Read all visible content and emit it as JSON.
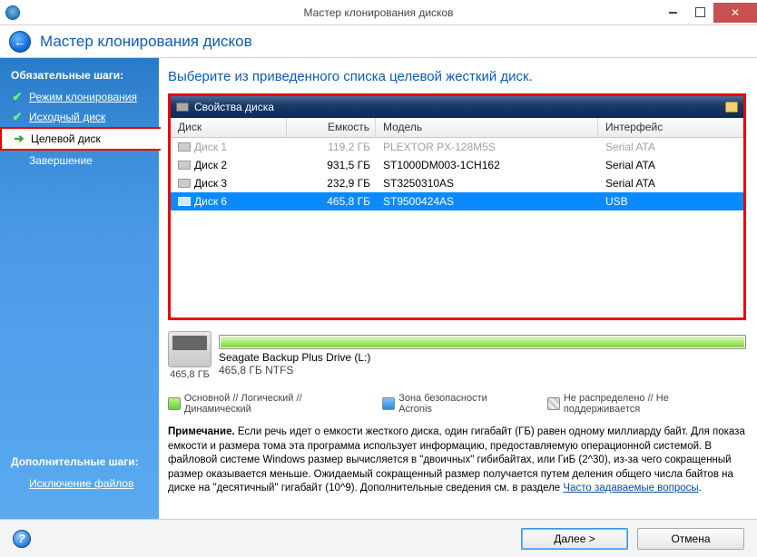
{
  "window": {
    "title": "Мастер клонирования дисков"
  },
  "header": {
    "title": "Мастер клонирования дисков"
  },
  "sidebar": {
    "required_label": "Обязательные шаги:",
    "additional_label": "Дополнительные шаги:",
    "items": [
      {
        "label": "Режим клонирования",
        "done": true
      },
      {
        "label": "Исходный диск",
        "done": true
      },
      {
        "label": "Целевой диск",
        "active": true
      },
      {
        "label": "Завершение"
      }
    ],
    "additional_items": [
      {
        "label": "Исключение файлов"
      }
    ]
  },
  "main": {
    "heading": "Выберите из приведенного списка целевой жесткий диск.",
    "panel_title": "Свойства диска",
    "columns": {
      "disk": "Диск",
      "capacity": "Емкость",
      "model": "Модель",
      "interface": "Интерфейс"
    },
    "rows": [
      {
        "disk": "Диск 1",
        "capacity": "119,2 ГБ",
        "model": "PLEXTOR PX-128M5S",
        "iface": "Serial ATA",
        "state": "disabled"
      },
      {
        "disk": "Диск 2",
        "capacity": "931,5 ГБ",
        "model": "ST1000DM003-1CH162",
        "iface": "Serial ATA",
        "state": "normal"
      },
      {
        "disk": "Диск 3",
        "capacity": "232,9 ГБ",
        "model": "ST3250310AS",
        "iface": "Serial ATA",
        "state": "normal"
      },
      {
        "disk": "Диск 6",
        "capacity": "465,8 ГБ",
        "model": "ST9500424AS",
        "iface": "USB",
        "state": "selected"
      }
    ]
  },
  "partition": {
    "drive_capacity": "465,8 ГБ",
    "label": "Seagate Backup Plus Drive (L:)",
    "sub": "465,8 ГБ  NTFS"
  },
  "legend": {
    "primary": "Основной // Логический // Динамический",
    "zone": "Зона безопасности Acronis",
    "unalloc": "Не распределено // Не поддерживается"
  },
  "note": {
    "bold": "Примечание.",
    "text": " Если речь идет о емкости жесткого диска, один гигабайт (ГБ) равен одному миллиарду байт. Для показа емкости и размера тома эта программа использует информацию, предоставляемую операционной системой. В файловой системе Windows размер вычисляется в \"двоичных\" гибибайтах, или ГиБ (2^30), из-за чего сокращенный размер оказывается меньше. Ожидаемый сокращенный размер получается путем деления общего числа байтов на диске на \"десятичный\" гигабайт (10^9). Дополнительные сведения см. в разделе ",
    "link": "Часто задаваемые вопросы",
    "tail": "."
  },
  "footer": {
    "next": "Далее >",
    "cancel": "Отмена"
  }
}
